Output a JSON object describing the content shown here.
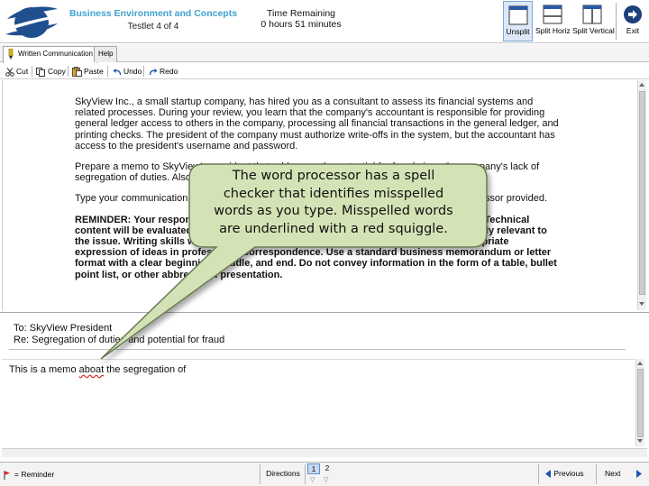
{
  "header": {
    "exam_title": "Business Environment and Concepts",
    "testlet": "Testlet 4 of 4",
    "time_label": "Time Remaining",
    "time_value": "0 hours 51 minutes",
    "buttons": {
      "unsplit": "Unsplit",
      "split_horz": "Split Horiz",
      "split_vertical": "Split Vertical",
      "exit": "Exit"
    }
  },
  "tabs": {
    "written_communication": "Written Communication",
    "help": "Help"
  },
  "edit_toolbar": {
    "cut": "Cut",
    "copy": "Copy",
    "paste": "Paste",
    "undo": "Undo",
    "redo": "Redo"
  },
  "question": {
    "p1": "SkyView Inc., a small startup company, has hired you as a consultant to assess its financial systems and related processes. During your review, you learn that the company's accountant is responsible for providing general ledger access to others in the company, processing all financial transactions in the general ledger, and printing checks. The president of the company must authorize write-offs in the system, but the accountant has access to the president's username and password.",
    "p2": "Prepare a memo to SkyView's president that addresses the potential for fraud given the company's lack of segregation of duties. Also address the possibility of fraud through the system.",
    "p3": "Type your communication in the response area below the horizontal line using the word processor provided.",
    "p4": "REMINDER: Your response will be graded for both technical content and writing skills. Technical content will be evaluated for information that is helpful to the intended reader and clearly relevant to the issue. Writing skills will be evaluated for development, organization, and the appropriate expression of ideas in professional correspondence. Use a standard business memorandum or letter format with a clear beginning, middle, and end. Do not convey information in the form of a table, bullet point list, or other abbreviated presentation."
  },
  "memo": {
    "to": "To: SkyView President",
    "re": "Re: Segregation of duties and potential for fraud"
  },
  "answer": {
    "before": "This is a memo ",
    "misspelled": "aboat",
    "after": " the segregation of"
  },
  "callout": {
    "line1": "The word processor has a spell",
    "line2": "checker that identifies misspelled",
    "line3": "words as you type. Misspelled words",
    "line4": "are underlined with a red squiggle."
  },
  "bottom": {
    "reminder": "= Reminder",
    "directions": "Directions",
    "questions": [
      "1",
      "2"
    ],
    "previous": "Previous",
    "next": "Next"
  },
  "colors": {
    "title_blue": "#3fa2cf",
    "callout_fill": "#d4e3b5",
    "callout_border": "#6b7a54",
    "misspell_red": "#dd2222"
  }
}
